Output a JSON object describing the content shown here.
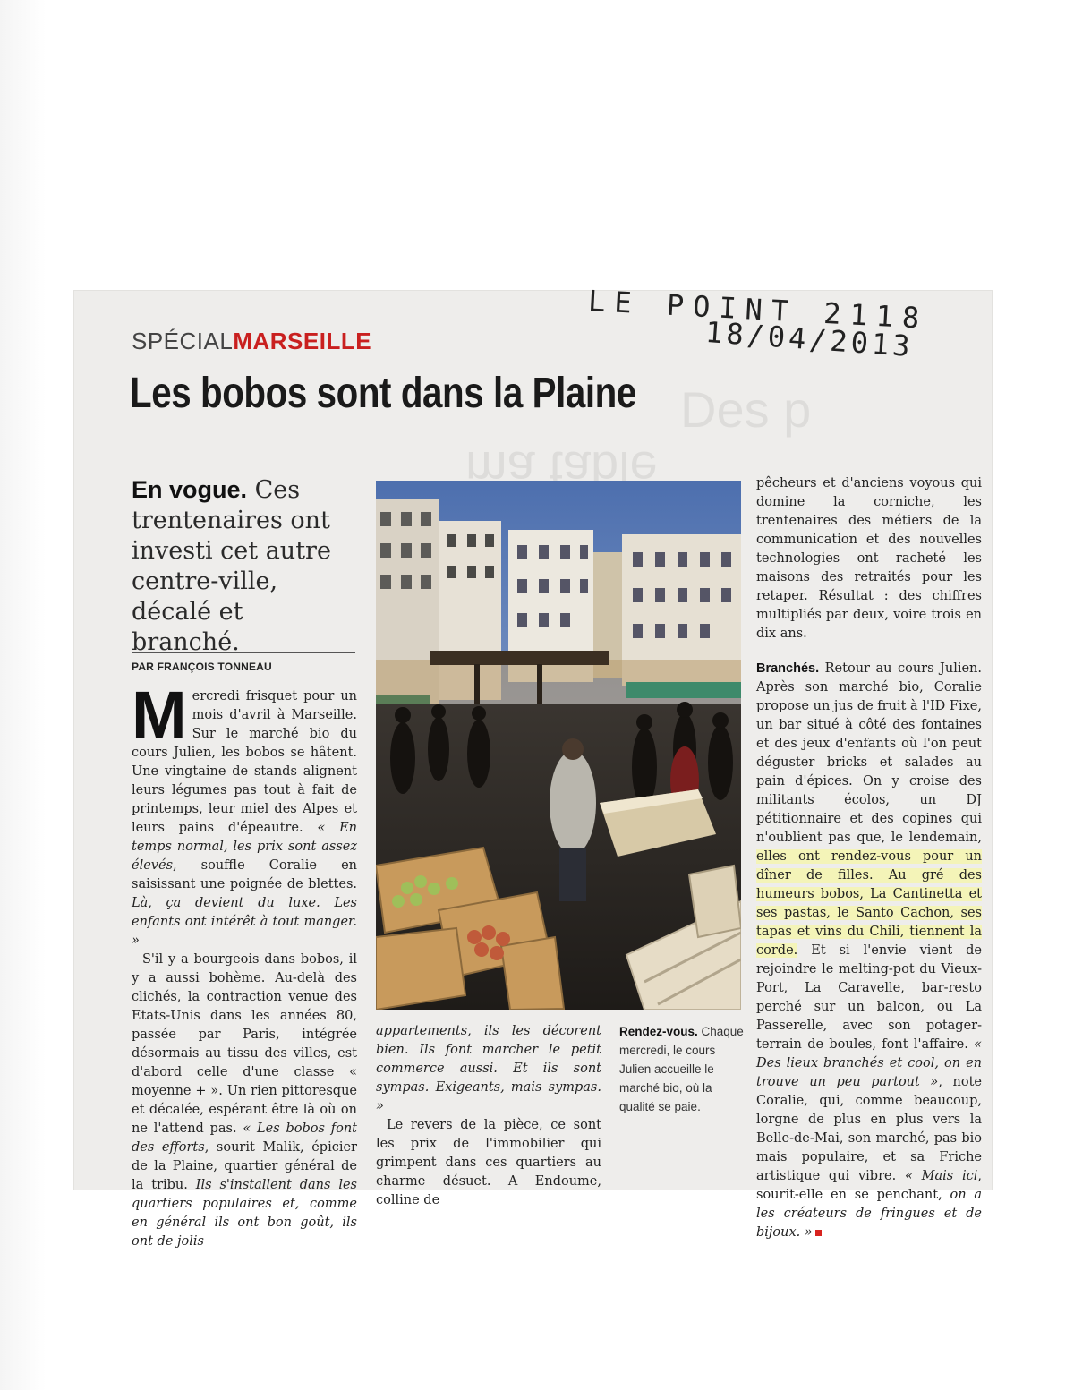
{
  "annotation": {
    "line1": "LE POINT 2118",
    "line2": "18/04/2013"
  },
  "ghost": {
    "text1": "Des p",
    "text2": "ma table"
  },
  "article": {
    "kicker": {
      "part1": "SPÉCIAL",
      "part2": "MARSEILLE"
    },
    "headline": "Les bobos sont dans la Plaine",
    "standfirst": {
      "lead": "En vogue.",
      "text": " Ces trentenaires ont investi cet autre centre-ville, décalé et branché."
    },
    "byline": "PAR FRANÇOIS TONNEAU",
    "col1": {
      "dropcap": "M",
      "p1a": "ercredi frisquet pour un mois d'avril à Marseille. Sur le marché bio du cours Julien, les bobos se hâtent. Une vingtaine de stands alignent leurs légumes pas tout à fait de printemps, leur miel des Alpes et leurs pains d'épeautre. ",
      "p1b": "« En temps normal, les prix sont assez élevés",
      "p1c": ", souffle Coralie en saisissant une poignée de blettes. ",
      "p1d": "Là, ça devient du luxe. Les enfants ont intérêt à tout manger. »",
      "p2a": "S'il y a bourgeois dans bobos, il y a aussi bohème. Au-delà des clichés, la contraction venue des Etats-Unis dans les années 80, passée par Paris, intégrée désormais au tissu des villes, est d'abord celle d'une classe « moyenne + ». Un rien pittoresque et décalée, espérant être là où on ne l'attend pas. ",
      "p2b": "« Les bobos font des efforts",
      "p2c": ", sourit Malik, épicier de la Plaine, quartier général de la tribu. ",
      "p2d": "Ils s'installent dans les quartiers populaires et, comme en général ils ont bon goût, ils ont de jolis"
    },
    "col2": {
      "p1": "appartements, ils les décorent bien. Ils font marcher le petit commerce aussi. Et ils sont sympas. Exigeants, mais sympas. »",
      "p2": "Le revers de la pièce, ce sont les prix de l'immobilier qui grimpent dans ces quartiers au charme désuet. A Endoume, colline de"
    },
    "caption": {
      "lead": "Rendez-vous.",
      "text": " Chaque mercredi, le cours Julien accueille le marché bio, où la qualité se paie."
    },
    "col3": {
      "p1": "pêcheurs et d'anciens voyous qui domine la corniche, les trentenaires des métiers de la communication et des nouvelles technologies ont racheté les maisons des retraités pour les retaper. Résultat : des chiffres multipliés par deux, voire trois en dix ans.",
      "subhead": "Branchés.",
      "p2a": " Retour au cours Julien. Après son marché bio, Coralie propose un jus de fruit à l'ID Fixe, un bar situé à côté des fontaines et des jeux d'enfants où l'on peut déguster bricks et salades au pain d'épices. On y croise des militants écolos, un DJ pétitionnaire et des copines qui n'oublient pas que, le lendemain, ",
      "p2hl": "elles ont rendez-vous pour un dîner de filles. Au gré des humeurs bobos, La Cantinetta et ses pastas, le Santo Cachon, ses tapas et vins du Chili, tiennent la corde.",
      "p2b": " Et si l'envie vient de rejoindre le melting-pot du Vieux-Port, La Caravelle, bar-resto perché sur un balcon, ou La Passerelle, avec son potager-terrain de boules, font l'affaire. ",
      "p2c": "« Des lieux branchés et cool, on en trouve un peu partout »",
      "p2d": ", note Coralie, qui, comme beaucoup, lorgne de plus en plus vers la Belle-de-Mai, son marché, pas bio mais populaire, et sa Friche artistique qui vibre. ",
      "p2e": "« Mais ici",
      "p2f": ", sourit-elle en se penchant, ",
      "p2g": "on a les créateurs de fringues et de bijoux. »"
    }
  },
  "colors": {
    "accent": "#c9201f",
    "paper": "#eeedeb",
    "highlight": "#f4f4b8"
  }
}
